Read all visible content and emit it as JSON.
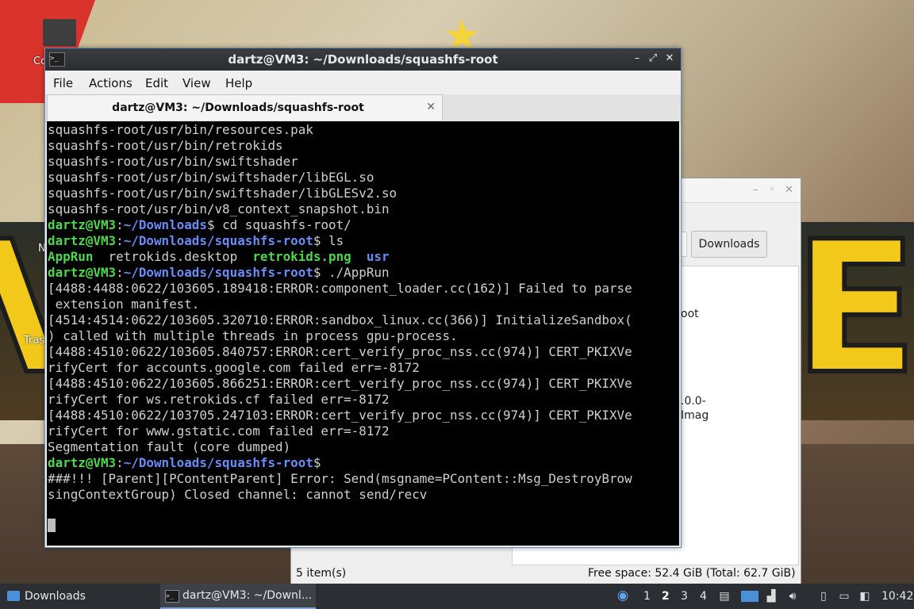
{
  "desktop": {
    "icon_labels": [
      "Co",
      "N",
      "Tras"
    ]
  },
  "file_manager": {
    "path_button": "Downloads",
    "fragments": [
      "oot",
      ".0.0-",
      "Imag"
    ],
    "status_items": "5 item(s)",
    "status_space": "Free space: 52.4 GiB (Total: 62.7 GiB)",
    "window_buttons": [
      "–",
      "◦",
      "✕"
    ]
  },
  "terminal": {
    "title": "dartz@VM3: ~/Downloads/squashfs-root",
    "menu": [
      "File",
      "Actions",
      "Edit",
      "View",
      "Help"
    ],
    "tab_label": "dartz@VM3: ~/Downloads/squashfs-root",
    "lines": {
      "l1": "squashfs-root/usr/bin/resources.pak",
      "l2": "squashfs-root/usr/bin/retrokids",
      "l3": "squashfs-root/usr/bin/swiftshader",
      "l4": "squashfs-root/usr/bin/swiftshader/libEGL.so",
      "l5": "squashfs-root/usr/bin/swiftshader/libGLESv2.so",
      "l6": "squashfs-root/usr/bin/v8_context_snapshot.bin",
      "p7_user": "dartz@VM3",
      "p7_path": "~/Downloads",
      "p7_cmd": "$ cd squashfs-root/",
      "p8_user": "dartz@VM3",
      "p8_path": "~/Downloads/squashfs-root",
      "p8_cmd": "$ ls",
      "ls_apprun": "AppRun",
      "ls_desktop": "retrokids.desktop",
      "ls_png": "retrokids.png",
      "ls_usr": "usr",
      "p10_user": "dartz@VM3",
      "p10_path": "~/Downloads/squashfs-root",
      "p10_cmd": "$ ./AppRun",
      "l11": "[4488:4488:0622/103605.189418:ERROR:component_loader.cc(162)] Failed to parse",
      "l12": " extension manifest.",
      "l13": "[4514:4514:0622/103605.320710:ERROR:sandbox_linux.cc(366)] InitializeSandbox(",
      "l14": ") called with multiple threads in process gpu-process.",
      "l15": "[4488:4510:0622/103605.840757:ERROR:cert_verify_proc_nss.cc(974)] CERT_PKIXVe",
      "l16": "rifyCert for accounts.google.com failed err=-8172",
      "l17": "[4488:4510:0622/103605.866251:ERROR:cert_verify_proc_nss.cc(974)] CERT_PKIXVe",
      "l18": "rifyCert for ws.retrokids.cf failed err=-8172",
      "l19": "[4488:4510:0622/103705.247103:ERROR:cert_verify_proc_nss.cc(974)] CERT_PKIXVe",
      "l20": "rifyCert for www.gstatic.com failed err=-8172",
      "l21": "Segmentation fault (core dumped)",
      "p22_user": "dartz@VM3",
      "p22_path": "~/Downloads/squashfs-root",
      "p22_cmd": "$",
      "l23": "###!!! [Parent][PContentParent] Error: Send(msgname=PContent::Msg_DestroyBrow",
      "l24": "singContextGroup) Closed channel: cannot send/recv"
    },
    "colors": {
      "prompt": "#4fd64f",
      "path": "#6a8cf7",
      "text": "#cfcfcf",
      "background": "#000000"
    }
  },
  "taskbar": {
    "downloads_label": "Downloads",
    "terminal_label": "dartz@VM3: ~/Downl...",
    "workspaces": [
      "1",
      "2",
      "3",
      "4"
    ],
    "current_workspace": "2",
    "clock": "10:42"
  }
}
